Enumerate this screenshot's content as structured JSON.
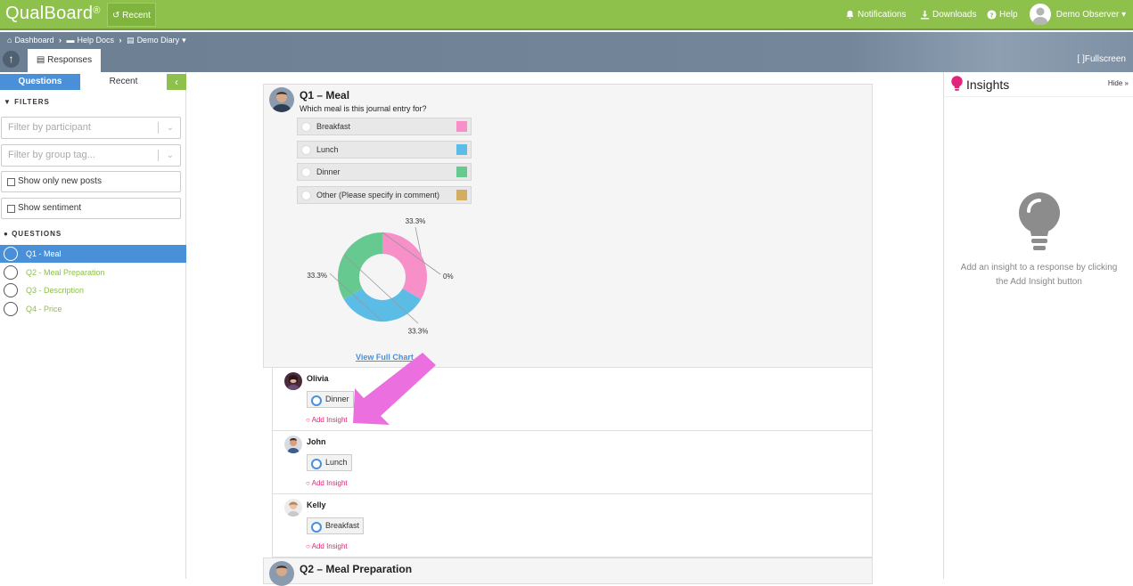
{
  "app": {
    "logo": "QualBoard",
    "logo_mark": "®",
    "recent": "Recent"
  },
  "topnav": {
    "notifications": "Notifications",
    "downloads": "Downloads",
    "help": "Help",
    "user": "Demo Observer"
  },
  "breadcrumb": {
    "dashboard": "Dashboard",
    "help_docs": "Help Docs",
    "demo_diary": "Demo Diary"
  },
  "toolbar": {
    "tab_responses": "Responses",
    "fullscreen": "Fullscreen"
  },
  "sidebar": {
    "tab_questions": "Questions",
    "tab_recent": "Recent",
    "filters_title": "FILTERS",
    "filter_participant": "Filter by participant",
    "filter_group": "Filter by group tag...",
    "show_new": "Show only new posts",
    "show_sentiment": "Show sentiment",
    "questions_title": "QUESTIONS",
    "questions": [
      {
        "label": "Q1 - Meal",
        "active": true
      },
      {
        "label": "Q2 - Meal Preparation",
        "active": false
      },
      {
        "label": "Q3 - Description",
        "active": false
      },
      {
        "label": "Q4 - Price",
        "active": false
      }
    ]
  },
  "question1": {
    "title": "Q1 – Meal",
    "prompt": "Which meal is this journal entry for?",
    "options": [
      {
        "label": "Breakfast",
        "color": "#f78fc9"
      },
      {
        "label": "Lunch",
        "color": "#5bbde6"
      },
      {
        "label": "Dinner",
        "color": "#66c98f"
      },
      {
        "label": "Other (Please specify in comment)",
        "color": "#d4ad64"
      }
    ],
    "view_full_chart": "View Full Chart"
  },
  "chart_data": {
    "type": "pie",
    "categories": [
      "Breakfast",
      "Lunch",
      "Dinner",
      "Other (Please specify in comment)"
    ],
    "values": [
      33.3,
      33.3,
      33.3,
      0
    ],
    "data_labels": [
      "33.3%",
      "33.3%",
      "33.3%",
      "0%"
    ],
    "colors": [
      "#f78fc9",
      "#5bbde6",
      "#66c98f",
      "#d4ad64"
    ]
  },
  "responses": [
    {
      "name": "Olivia",
      "answer": "Dinner",
      "add_insight": "Add Insight"
    },
    {
      "name": "John",
      "answer": "Lunch",
      "add_insight": "Add Insight"
    },
    {
      "name": "Kelly",
      "answer": "Breakfast",
      "add_insight": "Add Insight"
    }
  ],
  "question2": {
    "title": "Q2 – Meal Preparation"
  },
  "insights": {
    "title": "Insights",
    "hide": "Hide",
    "empty_message": "Add an insight to a response by clicking the Add Insight button"
  }
}
